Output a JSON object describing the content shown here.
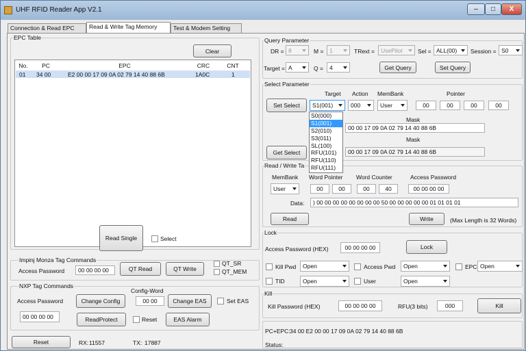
{
  "window": {
    "title": "UHF RFID Reader App V2.1",
    "min": "–",
    "max": "□",
    "close": "X"
  },
  "tabs": [
    {
      "label": "Connection & Read EPC"
    },
    {
      "label": "Read & Write Tag Memory"
    },
    {
      "label": "Test & Modem Setting"
    }
  ],
  "epc_table": {
    "title": "EPC Table",
    "clear": "Clear",
    "columns": [
      "No.",
      "PC",
      "EPC",
      "CRC",
      "CNT"
    ],
    "rows": [
      {
        "no": "01",
        "pc": "34 00",
        "epc": "E2 00 00 17 09 0A 02 79 14 40 88 6B",
        "crc": "1A0C",
        "cnt": "1"
      }
    ]
  },
  "read_single": {
    "button": "Read Single",
    "select_label": "Select"
  },
  "impinj": {
    "title": "Impinj Monza Tag Commands",
    "access_label": "Access Password",
    "access_value": "00 00 00 00",
    "qt_read": "QT Read",
    "qt_write": "QT Write",
    "qt_sr": "QT_SR",
    "qt_mem": "QT_MEM"
  },
  "nxp": {
    "title": "NXP Tag Commands",
    "access_label": "Access Password",
    "access_value": "00 00 00 00",
    "change_config": "Change Config",
    "config_word_label": "Config-Word",
    "config_word": "00 00",
    "change_eas": "Change EAS",
    "set_eas": "Set EAS",
    "read_protect": "ReadProtect",
    "reset_chk": "Reset",
    "eas_alarm": "EAS Alarm"
  },
  "status_bar": {
    "reset": "Reset",
    "rx_label": "RX:",
    "rx": "11557",
    "tx_label": "TX:",
    "tx": "17887"
  },
  "query": {
    "title": "Query Parameter",
    "dr_label": "DR =",
    "dr": "8",
    "m_label": "M =",
    "m": "1",
    "trext_label": "TRext =",
    "trext": "UsePilot",
    "sel_label": "Sel =",
    "sel": "ALL(00)",
    "session_label": "Session =",
    "session": "S0",
    "target_label": "Target =",
    "target": "A",
    "q_label": "Q =",
    "q": "4",
    "get_query": "Get Query",
    "set_query": "Set Query"
  },
  "select_param": {
    "title": "Select Parameter",
    "target_col": "Target",
    "action_col": "Action",
    "membank_col": "MemBank",
    "pointer_col": "Pointer",
    "set_select": "Set Select",
    "target": "S1(001)",
    "action": "000",
    "membank": "User",
    "pointer": [
      "00",
      "00",
      "00",
      "00"
    ],
    "mask_label": "Mask",
    "mask": "00 00 17 09 0A 02 79 14 40 88 6B",
    "get_select": "Get Select",
    "mask2_label": "Mask",
    "mask2": "00 00 17 09 0A 02 79 14 40 88 6B"
  },
  "target_dropdown": {
    "options": [
      "S0(000)",
      "S1(001)",
      "S2(010)",
      "S3(011)",
      "SL(100)",
      "RFU(101)",
      "RFU(110)",
      "RFU(111)"
    ],
    "selected": "S1(001)"
  },
  "rw": {
    "title": "Read / Write Ta",
    "membank_label": "MemBank",
    "membank": "User",
    "word_pointer_label": "Word Pointer",
    "wp": [
      "00",
      "00"
    ],
    "word_counter_label": "Word Counter",
    "wc": [
      "00",
      "40"
    ],
    "access_label": "Access Password",
    "access": "00 00 00 00",
    "data_label": "Data:",
    "data": ") 00 00 00 00 00 00 00 00 50 00 00 00 00 00 01 01 01 01",
    "read": "Read",
    "write": "Write",
    "maxlen": "(Max Length is 32 Words)"
  },
  "lock": {
    "title": "Lock",
    "access_label": "Access Password (HEX)",
    "access": "00 00 00 00",
    "lock_btn": "Lock",
    "kill_pwd": "Kill Pwd",
    "kill_pwd_val": "Open",
    "access_pwd": "Access Pwd",
    "access_pwd_val": "Open",
    "epc": "EPC",
    "epc_val": "Open",
    "tid": "TID",
    "tid_val": "Open",
    "user": "User",
    "user_val": "Open"
  },
  "kill": {
    "title": "Kill",
    "pwd_label": "Kill Password (HEX)",
    "pwd": "00 00 00 00",
    "rfu_label": "RFU(3 bits)",
    "rfu": "000",
    "kill_btn": "Kill"
  },
  "result": {
    "pcepc_label": "PC+EPC:",
    "pcepc": "34 00 E2 00 00 17 09 0A 02 79 14 40 88 6B",
    "status_label": "Status:"
  }
}
